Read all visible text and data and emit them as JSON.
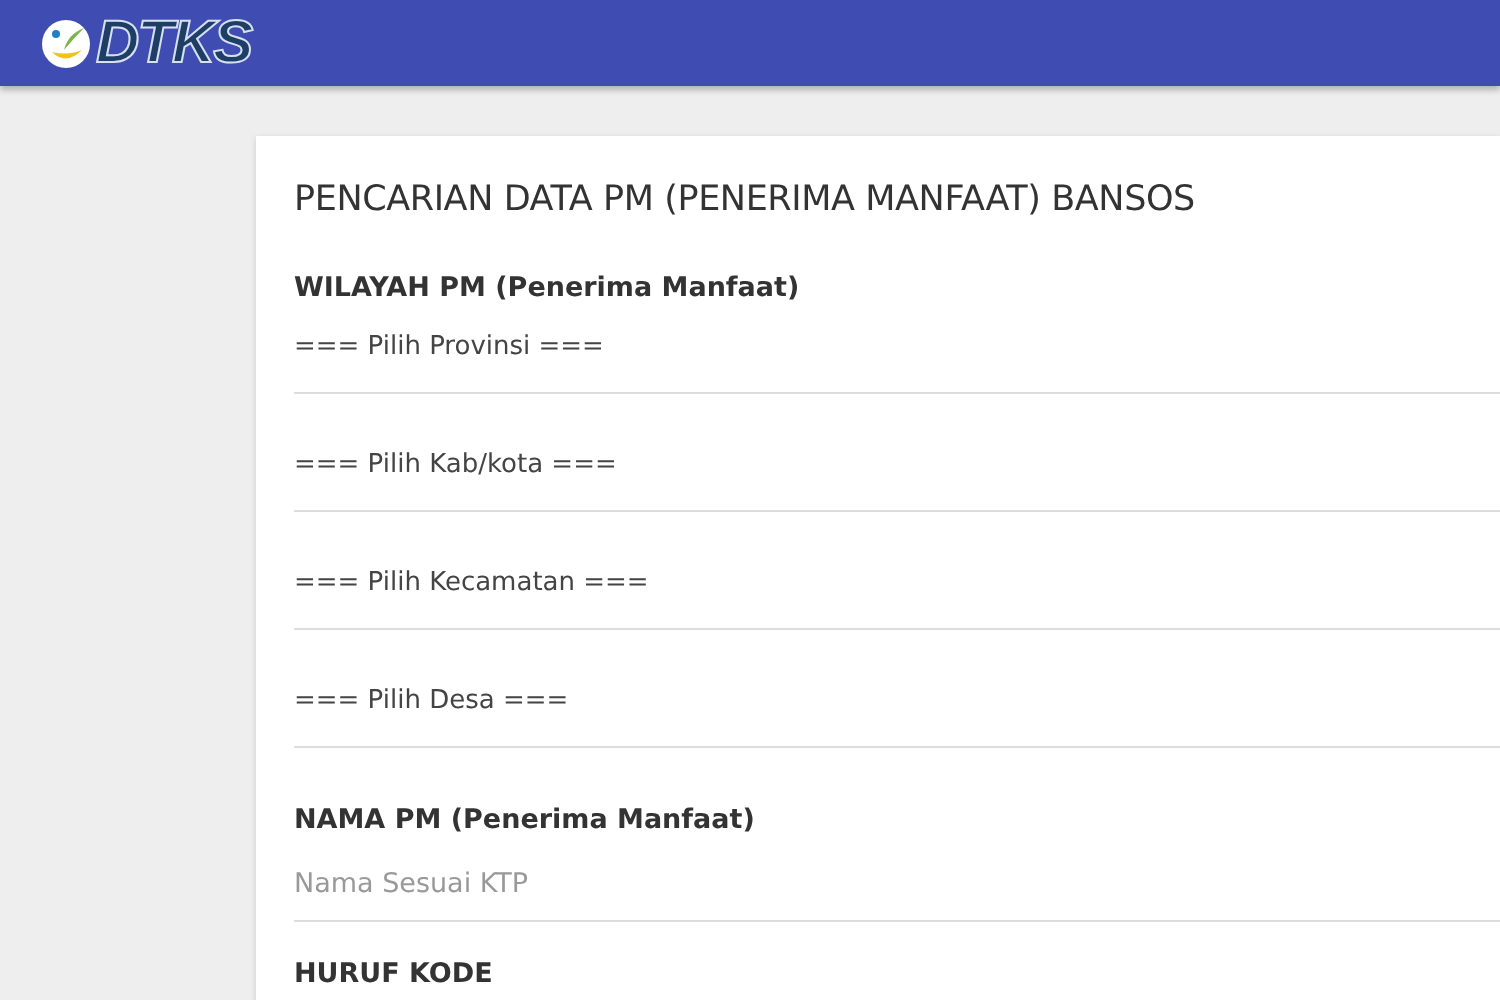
{
  "header": {
    "logo_text": "DTKS"
  },
  "form": {
    "title": "PENCARIAN DATA PM (PENERIMA MANFAAT) BANSOS",
    "region_label": "WILAYAH PM (Penerima Manfaat)",
    "selects": [
      "=== Pilih Provinsi ===",
      "=== Pilih Kab/kota ===",
      "=== Pilih Kecamatan ===",
      "=== Pilih Desa ==="
    ],
    "name_label": "NAMA PM (Penerima Manfaat)",
    "name_field": {
      "placeholder": "Nama Sesuai KTP"
    },
    "code_label": "HURUF KODE"
  }
}
